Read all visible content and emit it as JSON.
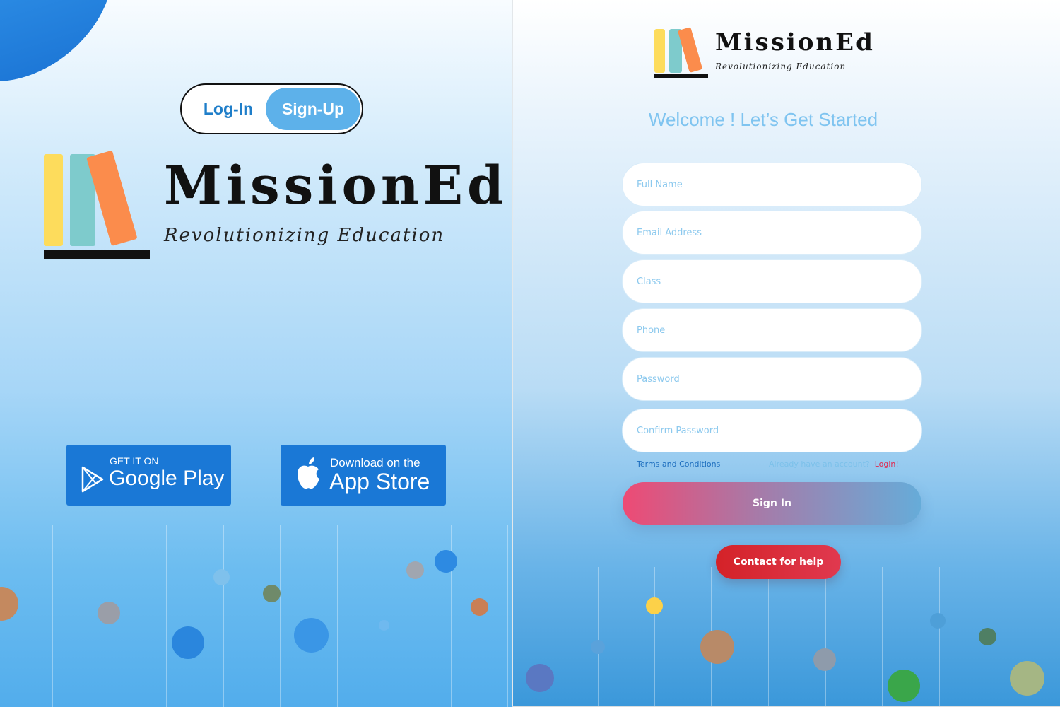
{
  "auth_toggle": {
    "login_label": "Log-In",
    "signup_label": "Sign-Up",
    "active": "Sign-Up"
  },
  "brand": {
    "name": "MissionEd",
    "tagline": "Revolutionizing Education"
  },
  "stores": {
    "google": {
      "small": "GET IT ON",
      "big": "Google Play"
    },
    "apple": {
      "small": "Download on the",
      "big": "App Store"
    }
  },
  "signup": {
    "welcome": "Welcome ! Let’s Get Started",
    "full_name_placeholder": "Full Name",
    "email_placeholder": "Email Address",
    "class_placeholder": "Class",
    "phone_placeholder": "Phone",
    "password_placeholder": "Password",
    "confirm_password_placeholder": "Confirm Password",
    "terms_label": "Terms and Conditions",
    "have_account_text": "Already have an account?",
    "login_link": "Login",
    "login_suffix": "!",
    "sign_in_label": "Sign In",
    "help_label": "Contact for help"
  },
  "colors": {
    "accent_blue": "#1a78d6",
    "toggle_active": "#5db1ea",
    "welcome_text": "#7fc4f0",
    "help_red": "#d42228",
    "login_red": "#e0284f"
  },
  "icons": [
    "google-play-icon",
    "apple-icon"
  ]
}
